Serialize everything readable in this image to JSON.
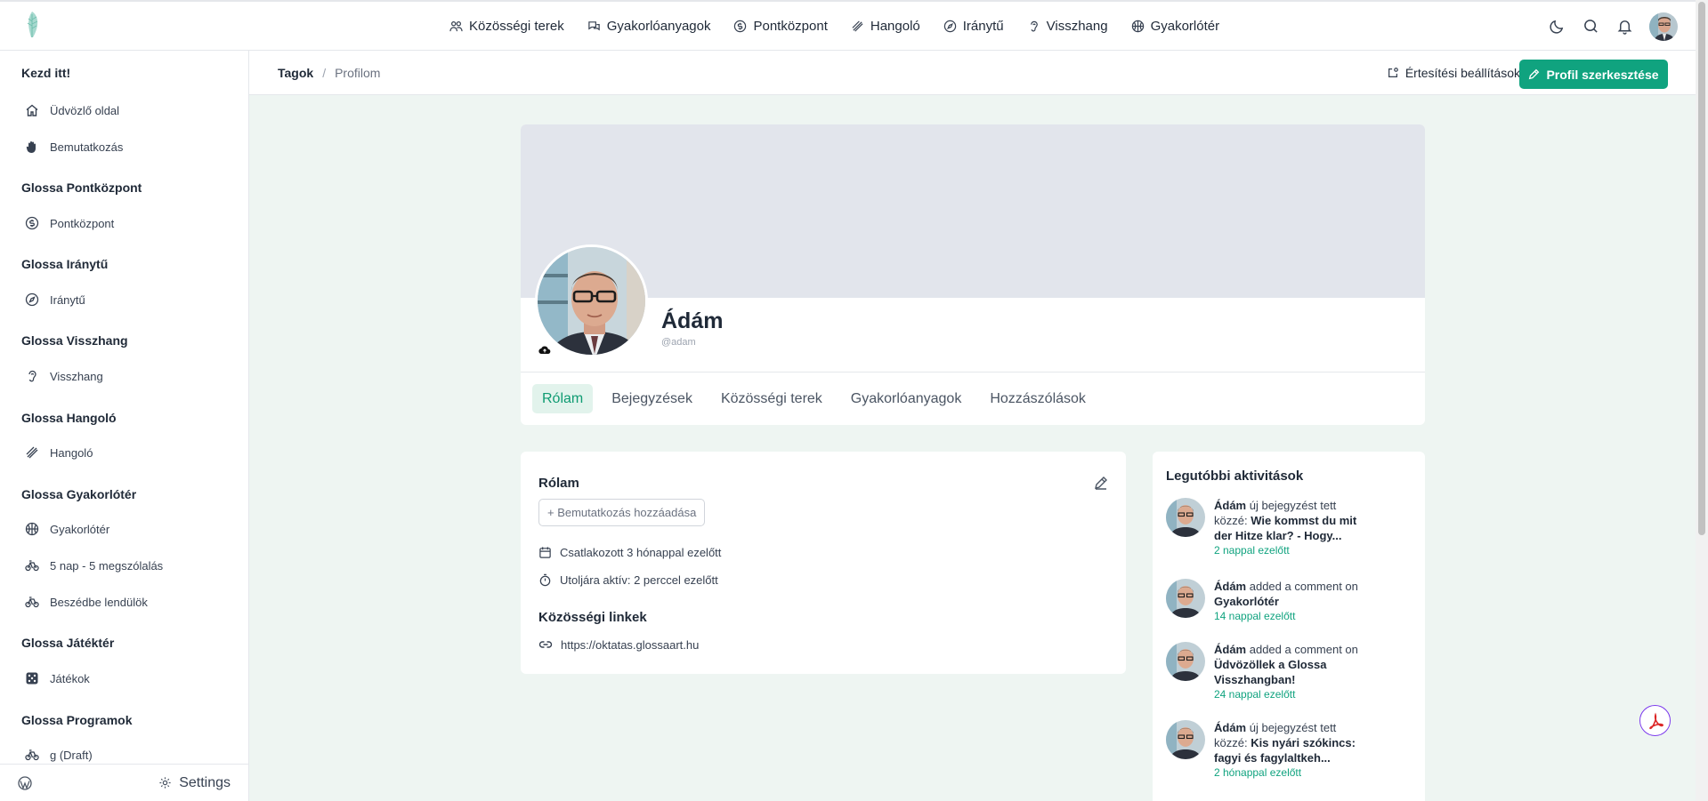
{
  "nav": {
    "items": [
      {
        "label": "Közösségi terek",
        "icon": "people-icon"
      },
      {
        "label": "Gyakorlóanyagok",
        "icon": "chat-bubbles-icon"
      },
      {
        "label": "Pontközpont",
        "icon": "dollar-circle-icon"
      },
      {
        "label": "Hangoló",
        "icon": "tuning-icon"
      },
      {
        "label": "Iránytű",
        "icon": "compass-icon"
      },
      {
        "label": "Visszhang",
        "icon": "ear-icon"
      },
      {
        "label": "Gyakorlótér",
        "icon": "basketball-icon"
      }
    ]
  },
  "sidebar": {
    "sections": [
      {
        "title": "Kezd itt!",
        "items": [
          {
            "label": "Üdvözlő oldal",
            "icon": "home-icon"
          },
          {
            "label": "Bemutatkozás",
            "icon": "waving-hand-icon"
          }
        ]
      },
      {
        "title": "Glossa Pontközpont",
        "items": [
          {
            "label": "Pontközpont",
            "icon": "dollar-circle-icon"
          }
        ]
      },
      {
        "title": "Glossa Iránytű",
        "items": [
          {
            "label": "Iránytű",
            "icon": "compass-icon"
          }
        ]
      },
      {
        "title": "Glossa Visszhang",
        "items": [
          {
            "label": "Visszhang",
            "icon": "ear-icon"
          }
        ]
      },
      {
        "title": "Glossa Hangoló",
        "items": [
          {
            "label": "Hangoló",
            "icon": "tuning-icon"
          }
        ]
      },
      {
        "title": "Glossa Gyakorlótér",
        "items": [
          {
            "label": "Gyakorlótér",
            "icon": "basketball-icon"
          },
          {
            "label": "5 nap - 5 megszólalás",
            "icon": "bicycle-icon"
          },
          {
            "label": "Beszédbe lendülök",
            "icon": "bicycle-icon"
          }
        ]
      },
      {
        "title": "Glossa Játéktér",
        "items": [
          {
            "label": "Játékok",
            "icon": "dice-icon"
          }
        ]
      },
      {
        "title": "Glossa Programok",
        "items": [
          {
            "label": "g (Draft)",
            "icon": "bicycle-icon"
          }
        ]
      }
    ],
    "settings_label": "Settings"
  },
  "breadcrumb": {
    "parent": "Tagok",
    "separator": "/",
    "current": "Profilom"
  },
  "header_actions": {
    "notif_label": "Értesítési beállítások",
    "edit_label": "Profil szerkesztése"
  },
  "profile": {
    "name": "Ádám",
    "handle": "@adam",
    "tabs": [
      "Rólam",
      "Bejegyzések",
      "Közösségi terek",
      "Gyakorlóanyagok",
      "Hozzászólások"
    ]
  },
  "about": {
    "title": "Rólam",
    "intro_button": "+ Bemutatkozás hozzáadása",
    "joined": "Csatlakozott 3 hónappal ezelőtt",
    "last_active": "Utoljára aktív: 2 perccel ezelőtt",
    "links_title": "Közösségi linkek",
    "link": "https://oktatas.glossaart.hu"
  },
  "activity": {
    "title": "Legutóbbi aktivitások",
    "items": [
      {
        "actor": "Ádám",
        "action": " új bejegyzést tett közzé: ",
        "target": "Wie kommst du mit der Hitze klar? - Hogy...",
        "time": "2 nappal ezelőtt"
      },
      {
        "actor": "Ádám",
        "action": " added a comment on ",
        "target": "Gyakorlótér",
        "time": "14 nappal ezelőtt"
      },
      {
        "actor": "Ádám",
        "action": " added a comment on ",
        "target": "Üdvözöllek a Glossa Visszhangban!",
        "time": "24 nappal ezelőtt"
      },
      {
        "actor": "Ádám",
        "action": " új bejegyzést tett közzé: ",
        "target": "Kis nyári szókincs: fagyi és fagylaltkeh...",
        "time": "2 hónappal ezelőtt"
      }
    ]
  },
  "colors": {
    "accent": "#10a37f",
    "background": "#eef5f2",
    "cover": "#e2e5ec"
  }
}
